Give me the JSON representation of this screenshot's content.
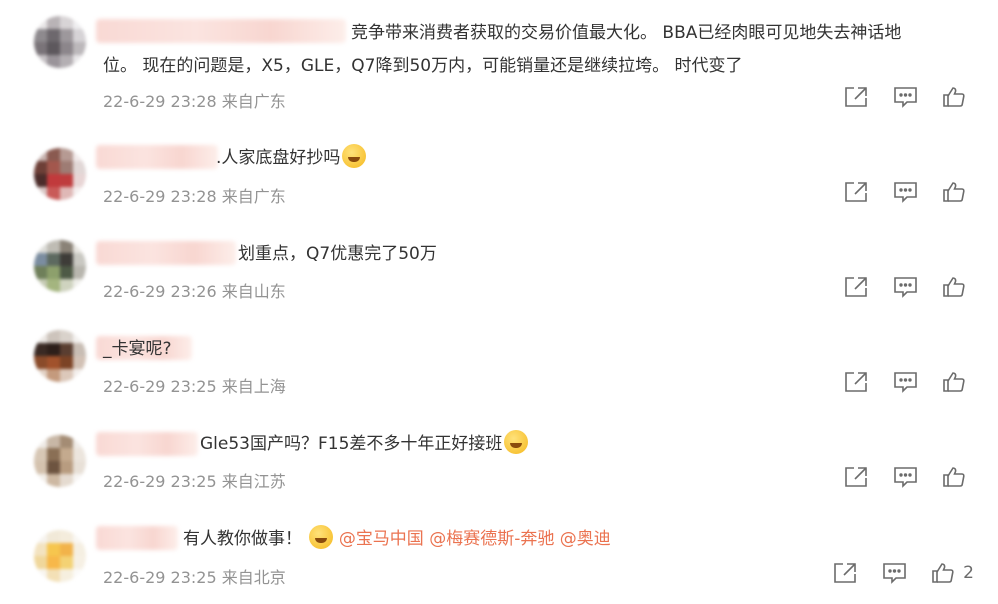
{
  "comments": [
    {
      "text_line1": "竞争带来消费者获取的交易价值最大化。 BBA已经肉眼可见地失去神话地",
      "text_line2": "位。 现在的问题是，X5，GLE，Q7降到50万内，可能销量还是继续拉垮。 时代变了",
      "meta": "22-6-29 23:28 来自广东",
      "like_count": ""
    },
    {
      "text": ".人家底盘好抄吗",
      "meta": "22-6-29 23:28 来自广东",
      "emoji": "shush-face-emoji",
      "like_count": ""
    },
    {
      "text": "划重点，Q7优惠完了50万",
      "meta": "22-6-29 23:26 来自山东",
      "like_count": ""
    },
    {
      "text": "_卡宴呢?",
      "meta": "22-6-29 23:25 来自上海",
      "like_count": ""
    },
    {
      "text": "Gle53国产吗？F15差不多十年正好接班",
      "meta": "22-6-29 23:25 来自江苏",
      "emoji": "grin-face-emoji",
      "like_count": ""
    },
    {
      "text": "有人教你做事！",
      "mentions": [
        "@宝马中国",
        "@梅赛德斯-奔驰",
        "@奥迪"
      ],
      "meta": "22-6-29 23:25 来自北京",
      "emoji": "thinking-face-emoji",
      "like_count": "2"
    }
  ],
  "colors": {
    "text": "#333333",
    "meta": "#939393",
    "mention": "#eb7350",
    "icon": "#6b6b6b"
  },
  "icons": {
    "share": "share-icon",
    "reply": "comment-icon",
    "like": "thumbs-up-icon"
  }
}
